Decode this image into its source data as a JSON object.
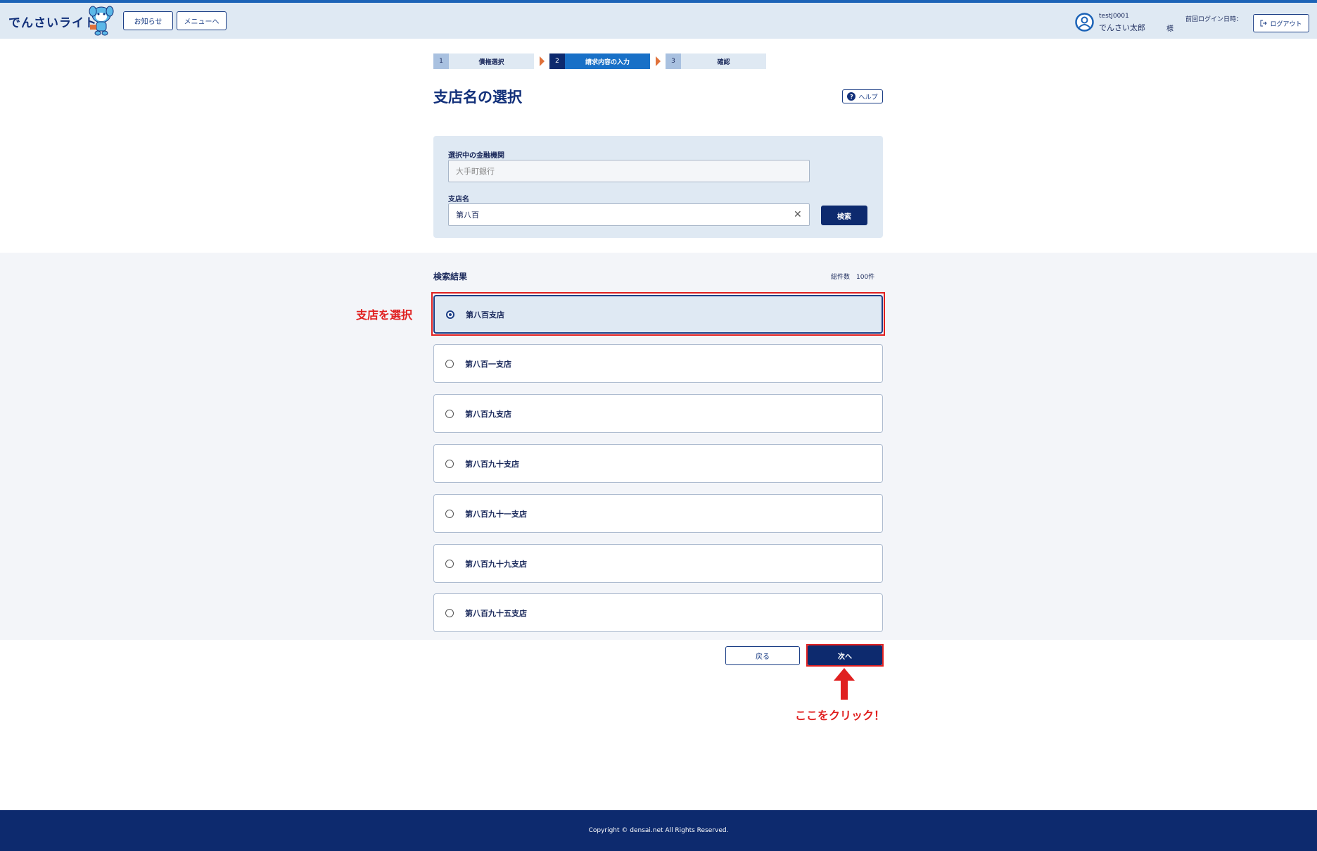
{
  "header": {
    "logo": "でんさいライト",
    "news_label": "お知らせ",
    "menu_label": "メニューへ",
    "user_id": "testJ0001",
    "user_name": "でんさい太郎",
    "honorific": "様",
    "last_login_label": "前回ログイン日時：",
    "logout_label": "ログアウト"
  },
  "steps": [
    {
      "num": "1",
      "label": "債権選択"
    },
    {
      "num": "2",
      "label": "請求内容の入力"
    },
    {
      "num": "3",
      "label": "確認"
    }
  ],
  "page_title": "支店名の選択",
  "help_label": "ヘルプ",
  "search": {
    "bank_label": "選択中の金融機関",
    "bank_value": "大手町銀行",
    "branch_label": "支店名",
    "branch_value": "第八百",
    "search_button": "検索"
  },
  "results": {
    "heading": "検索結果",
    "total": "総件数　100件",
    "items": [
      {
        "name": "第八百支店",
        "selected": true
      },
      {
        "name": "第八百一支店",
        "selected": false
      },
      {
        "name": "第八百九支店",
        "selected": false
      },
      {
        "name": "第八百九十支店",
        "selected": false
      },
      {
        "name": "第八百九十一支店",
        "selected": false
      },
      {
        "name": "第八百九十九支店",
        "selected": false
      },
      {
        "name": "第八百九十五支店",
        "selected": false
      }
    ]
  },
  "annotations": {
    "select_branch": "支店を選択",
    "click_here": "ここをクリック！"
  },
  "buttons": {
    "back": "戻る",
    "next": "次へ"
  },
  "footer": "Copyright © densai.net All Rights Reserved.",
  "colors": {
    "header_bg": "#dfe9f3",
    "primary": "#0d2a6e",
    "active_step": "#1870c7",
    "annotation_red": "#e02020"
  }
}
